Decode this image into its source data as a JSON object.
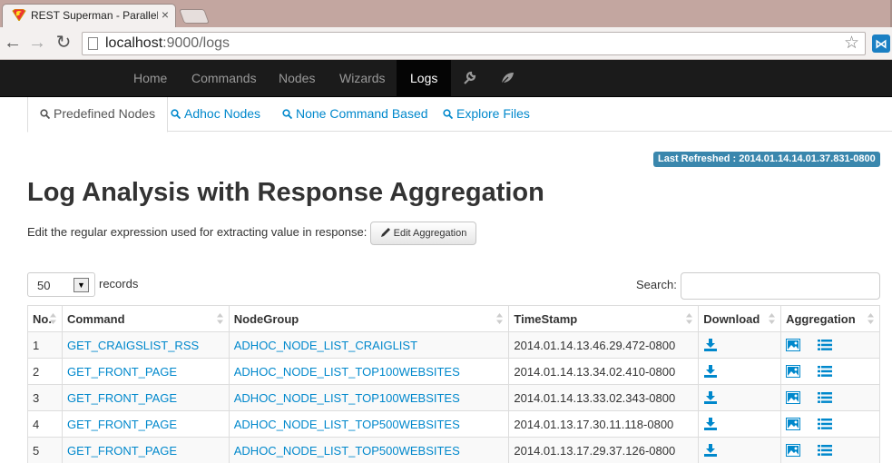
{
  "browser": {
    "tab_title": "REST Superman - Parallel",
    "url_host": "localhost",
    "url_rest": ":9000/logs"
  },
  "navbar": {
    "items": [
      {
        "label": "Home"
      },
      {
        "label": "Commands"
      },
      {
        "label": "Nodes"
      },
      {
        "label": "Wizards"
      },
      {
        "label": "Logs"
      }
    ]
  },
  "subtabs": [
    {
      "label": "Predefined Nodes"
    },
    {
      "label": "Adhoc Nodes"
    },
    {
      "label": "None Command Based"
    },
    {
      "label": "Explore Files"
    }
  ],
  "refresh_badge": "Last Refreshed : 2014.01.14.14.01.37.831-0800",
  "page_title": "Log Analysis with Response Aggregation",
  "edit": {
    "text": "Edit the regular expression used for extracting value in response:",
    "button": "Edit Aggregation"
  },
  "table_controls": {
    "records_value": "50",
    "records_label": "records",
    "search_label": "Search:"
  },
  "table": {
    "headers": [
      "No.",
      "Command",
      "NodeGroup",
      "TimeStamp",
      "Download",
      "Aggregation"
    ],
    "rows": [
      {
        "no": "1",
        "command": "GET_CRAIGSLIST_RSS",
        "nodegroup": "ADHOC_NODE_LIST_CRAIGLIST",
        "timestamp": "2014.01.14.13.46.29.472-0800"
      },
      {
        "no": "2",
        "command": "GET_FRONT_PAGE",
        "nodegroup": "ADHOC_NODE_LIST_TOP100WEBSITES",
        "timestamp": "2014.01.14.13.34.02.410-0800"
      },
      {
        "no": "3",
        "command": "GET_FRONT_PAGE",
        "nodegroup": "ADHOC_NODE_LIST_TOP100WEBSITES",
        "timestamp": "2014.01.14.13.33.02.343-0800"
      },
      {
        "no": "4",
        "command": "GET_FRONT_PAGE",
        "nodegroup": "ADHOC_NODE_LIST_TOP500WEBSITES",
        "timestamp": "2014.01.13.17.30.11.118-0800"
      },
      {
        "no": "5",
        "command": "GET_FRONT_PAGE",
        "nodegroup": "ADHOC_NODE_LIST_TOP500WEBSITES",
        "timestamp": "2014.01.13.17.29.37.126-0800"
      }
    ]
  },
  "icons": {
    "favicon": "superman-shield-icon",
    "nav_extra": [
      "wrench-icon",
      "leaf-icon"
    ],
    "tab_search": "search-icon",
    "download": "download-icon",
    "aggregation": [
      "picture-icon",
      "list-icon"
    ]
  },
  "colors": {
    "link": "#0088cc",
    "badge": "#3a87ad",
    "navbar": "#1b1b1b"
  }
}
